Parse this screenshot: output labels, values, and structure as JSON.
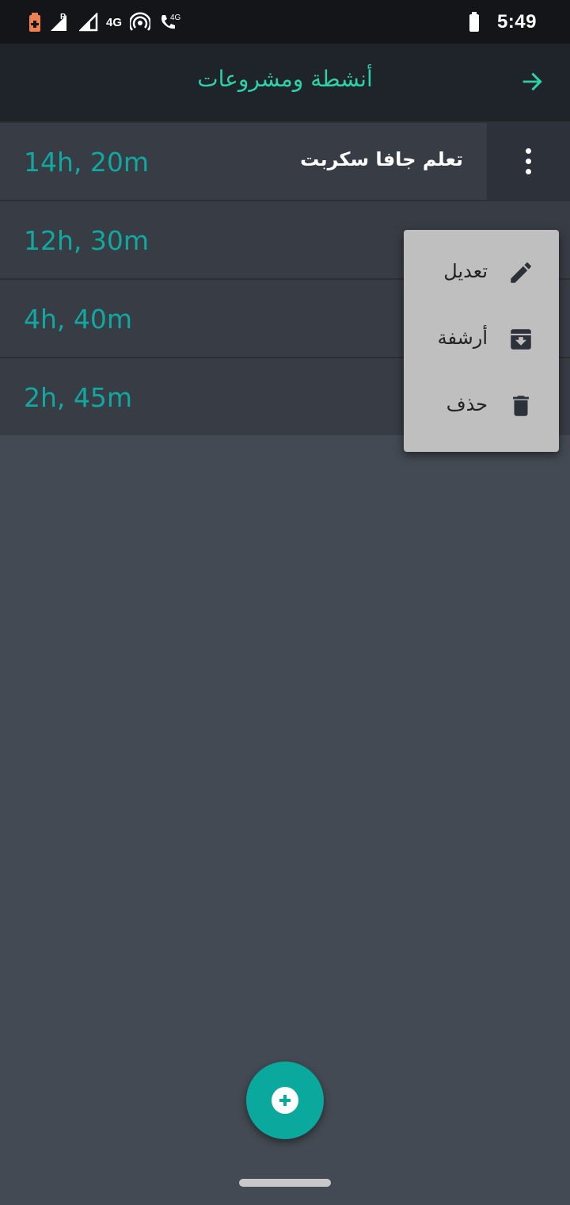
{
  "status_bar": {
    "network_label_1": "4G",
    "network_label_2": "4G",
    "roaming_label": "R",
    "time": "5:49"
  },
  "app_bar": {
    "title": "أنشطة ومشروعات",
    "back_icon": "arrow-forward-icon"
  },
  "activities": [
    {
      "name": "تعلم جافا سكربت",
      "duration": "14h, 20m"
    },
    {
      "name": "",
      "duration": "12h, 30m"
    },
    {
      "name": "",
      "duration": "4h, 40m"
    },
    {
      "name": "",
      "duration": "2h, 45m"
    }
  ],
  "context_menu": {
    "items": [
      {
        "label": "تعديل",
        "icon": "pencil-icon"
      },
      {
        "label": "أرشفة",
        "icon": "archive-icon"
      },
      {
        "label": "حذف",
        "icon": "trash-icon"
      }
    ]
  },
  "fab": {
    "icon": "plus-icon"
  },
  "colors": {
    "accent": "#2ed0a8",
    "duration_text": "#10a89f",
    "fab": "#0aa89d",
    "menu_bg": "#bfbfbf",
    "background": "#444a53"
  }
}
